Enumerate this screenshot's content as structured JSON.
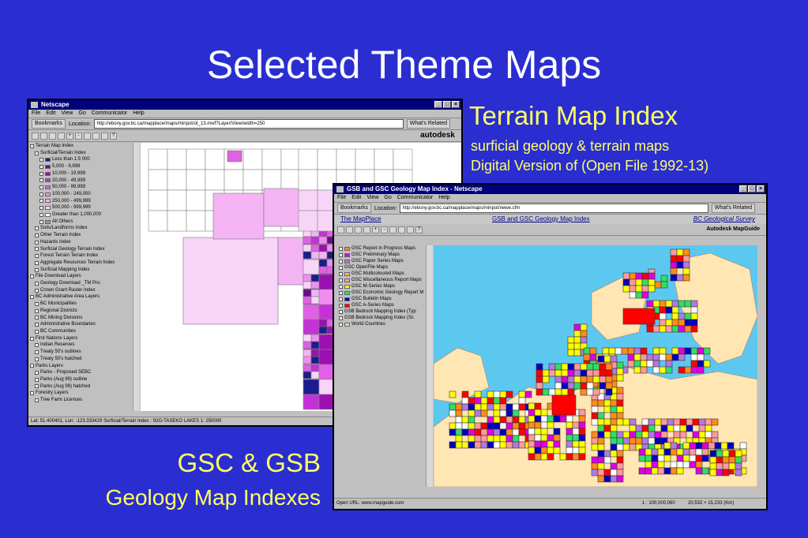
{
  "slide": {
    "title": "Selected Theme Maps",
    "terrain_heading": "Terrain Map Index",
    "terrain_line1": "surficial geology & terrain maps",
    "terrain_line2": "Digital Version of  (Open File 1992-13)",
    "gsc_heading": "GSC & GSB",
    "gsc_line": "Geology Map Indexes"
  },
  "colors": {
    "background": "#2a2ed0",
    "caption": "#ffff66",
    "title": "#ffffff"
  },
  "window1": {
    "title": "Netscape",
    "menu": [
      "File",
      "Edit",
      "View",
      "Go",
      "Communicator",
      "Help"
    ],
    "bookmarks_label": "Bookmarks",
    "location_label": "Location:",
    "url": "http://ebony.gov.bc.ca/mapplace/maps/minpot/ot_13.mwf?Layer/View/width=250",
    "related_label": "What's Related",
    "brand": "autodesk",
    "layers": [
      {
        "label": "Terrain Map Index",
        "indent": 0,
        "swatch": ""
      },
      {
        "label": "Surficial/Terrain Index",
        "indent": 1,
        "swatch": ""
      },
      {
        "label": "Less than 1:5 000",
        "indent": 2,
        "swatch": "#1c1c8c"
      },
      {
        "label": "5,000 - 9,999",
        "indent": 2,
        "swatch": "#6a0c8a"
      },
      {
        "label": "10,000 - 19,999",
        "indent": 2,
        "swatch": "#9a10b0"
      },
      {
        "label": "20,000 - 49,999",
        "indent": 2,
        "swatch": "#c432d6"
      },
      {
        "label": "50,000 - 99,999",
        "indent": 2,
        "swatch": "#e060e6"
      },
      {
        "label": "100,000 - 249,000",
        "indent": 2,
        "swatch": "#f08ef0"
      },
      {
        "label": "250,000 - 499,999",
        "indent": 2,
        "swatch": "#f4b4f4"
      },
      {
        "label": "500,000 - 999,999",
        "indent": 2,
        "swatch": "#f8d4f8"
      },
      {
        "label": "Greater than 1,000,000",
        "indent": 2,
        "swatch": "#ffffff"
      },
      {
        "label": "All Others",
        "indent": 2,
        "swatch": "#999999"
      },
      {
        "label": "Soils/Landforms Index",
        "indent": 1,
        "swatch": ""
      },
      {
        "label": "Other Terrain Index",
        "indent": 1,
        "swatch": ""
      },
      {
        "label": "Hazards Index",
        "indent": 1,
        "swatch": ""
      },
      {
        "label": "Surficial Geology Terrain Index",
        "indent": 1,
        "swatch": ""
      },
      {
        "label": "Forest Terrain Terrain Index",
        "indent": 1,
        "swatch": ""
      },
      {
        "label": "Aggregate Resources Terrain Index",
        "indent": 1,
        "swatch": ""
      },
      {
        "label": "Surficial Mapping Index",
        "indent": 1,
        "swatch": ""
      },
      {
        "label": "File Download Layers",
        "indent": 0,
        "swatch": ""
      },
      {
        "label": "Geology Download _TM Pro.",
        "indent": 1,
        "swatch": ""
      },
      {
        "label": "Crown Grant Raster Index",
        "indent": 1,
        "swatch": ""
      },
      {
        "label": "BC Administrative Area Layers",
        "indent": 0,
        "swatch": ""
      },
      {
        "label": "BC Municipalities",
        "indent": 1,
        "swatch": ""
      },
      {
        "label": "Regional Districts",
        "indent": 1,
        "swatch": ""
      },
      {
        "label": "BC Mining Divisions",
        "indent": 1,
        "swatch": ""
      },
      {
        "label": "Administrative Boundaries",
        "indent": 1,
        "swatch": ""
      },
      {
        "label": "BC Communities",
        "indent": 1,
        "swatch": ""
      },
      {
        "label": "First Nations Layers",
        "indent": 0,
        "swatch": ""
      },
      {
        "label": "Indian Reserves",
        "indent": 1,
        "swatch": ""
      },
      {
        "label": "Treaty 50's outlines",
        "indent": 1,
        "swatch": ""
      },
      {
        "label": "Treaty 50's hatched",
        "indent": 1,
        "swatch": ""
      },
      {
        "label": "Parks Layers",
        "indent": 0,
        "swatch": ""
      },
      {
        "label": "Parks - Proposed SEBC",
        "indent": 1,
        "swatch": ""
      },
      {
        "label": "Parks (Aug 99) outline",
        "indent": 1,
        "swatch": ""
      },
      {
        "label": "Parks (Aug 99) hatched",
        "indent": 1,
        "swatch": ""
      },
      {
        "label": "Forestry Layers",
        "indent": 0,
        "swatch": ""
      },
      {
        "label": "Tree Farm Licences",
        "indent": 1,
        "swatch": ""
      }
    ],
    "status": "Lat: 51.400401, Lon: -123.333429    Surficial/Terrain Index : 92O-TASEKO LAKES 1: 250000"
  },
  "window2": {
    "title": "GSB and GSC Geology Map Index - Netscape",
    "menu": [
      "File",
      "Edit",
      "View",
      "Go",
      "Communicator",
      "Help"
    ],
    "bookmarks_label": "Bookmarks",
    "location_label": "Location:",
    "url": "http://ebony.gov.bc.ca/mapplace/maps/minpot/newe.cfm",
    "related_label": "What's Related",
    "header_left": "The MapPlace",
    "header_center": "GSB and GSC Geology Map Index",
    "header_right": "BC Geological Survey",
    "brand": "Autodesk MapGuide",
    "layers": [
      {
        "label": "GSC Report in Progress Maps",
        "swatch": "#ff8c1a"
      },
      {
        "label": "GSC Preliminary Maps",
        "swatch": "#e000e0"
      },
      {
        "label": "GSC Paper Series Maps",
        "swatch": "#b07ae0"
      },
      {
        "label": "GSC OpenFile Maps",
        "swatch": ""
      },
      {
        "label": "GSC Multicoloured Maps",
        "swatch": "#ffb27a"
      },
      {
        "label": "GSC Miscellaneous Report Maps",
        "swatch": "#ff9a9a"
      },
      {
        "label": "GSC M-Series Maps",
        "swatch": "#ffff00"
      },
      {
        "label": "GSC Economic Geology Report M",
        "swatch": "#33dd66"
      },
      {
        "label": "GSC Bulletin Maps",
        "swatch": "#0000c0"
      },
      {
        "label": "GSC A-Series Maps",
        "swatch": "#ff0000"
      },
      {
        "label": "GSB Bedrock Mapping Index (Typ",
        "swatch": ""
      },
      {
        "label": "GSB Bedrock Mapping Index (Sc",
        "swatch": ""
      },
      {
        "label": "World Countries",
        "swatch": "#ffcc99"
      }
    ],
    "status_left": "Open URL: www.mapguide.com",
    "status_scale": "1 : 100,000,060",
    "status_size": "20,532 × 15,233 (Km)"
  }
}
